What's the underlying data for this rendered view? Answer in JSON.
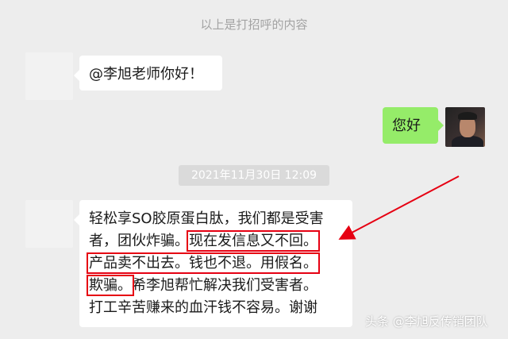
{
  "system_note": "以上是打招呼的内容",
  "messages": {
    "greeting": "@李旭老师你好！",
    "reply": "您好",
    "timestamp": "2021年11月30日 12:09",
    "complaint": {
      "line1": "轻松享SO胶原蛋白肽，我们都是受害",
      "line2_plain": "者，团伙炸骗。",
      "line2_boxed": "现在发信息又不回。",
      "line3_boxed": "产品卖不出去。钱也不退。用假名。",
      "line4_boxed": "欺骗。",
      "line4_plain": "希李旭帮忙解决我们受害者。",
      "line5": "打工辛苦赚来的血汗钱不容易。谢谢"
    }
  },
  "watermark": "头条 @李旭反传销团队",
  "colors": {
    "background": "#ededed",
    "incoming_bubble": "#ffffff",
    "outgoing_bubble": "#95ec69",
    "annotation_red": "#e60012"
  }
}
